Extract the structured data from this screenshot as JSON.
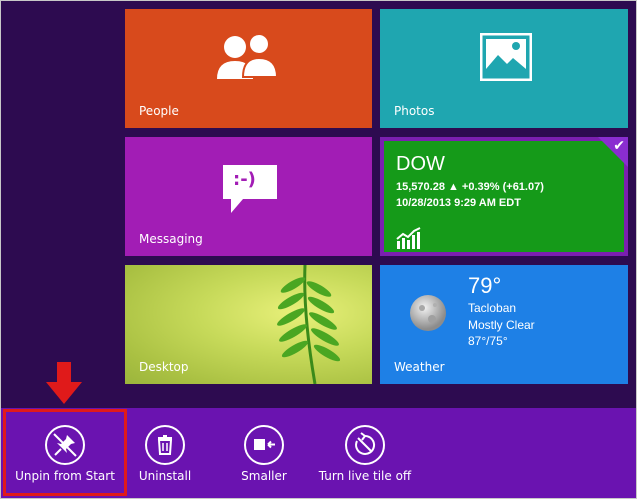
{
  "tiles": {
    "people": {
      "label": "People",
      "color": "#d84a1c"
    },
    "photos": {
      "label": "Photos",
      "color": "#1fa6b0"
    },
    "messaging": {
      "label": "Messaging",
      "color": "#a21db5",
      "icon_text": ":-)"
    },
    "dow": {
      "title": "DOW",
      "quote": "15,570.28 ▲ +0.39% (+61.07)",
      "timestamp": "10/28/2013 9:29 AM EDT",
      "color": "#159a19",
      "selected": true
    },
    "desktop": {
      "label": "Desktop"
    },
    "weather": {
      "label": "Weather",
      "temperature": "79°",
      "city": "Tacloban",
      "condition": "Mostly Clear",
      "range": "87°/75°",
      "color": "#1e80e6"
    }
  },
  "appbar": {
    "color": "#6a13b0",
    "commands": [
      {
        "label": "Unpin from Start",
        "icon": "unpin-icon"
      },
      {
        "label": "Uninstall",
        "icon": "trash-icon"
      },
      {
        "label": "Smaller",
        "icon": "resize-smaller-icon"
      },
      {
        "label": "Turn live tile off",
        "icon": "live-tile-off-icon"
      }
    ]
  },
  "annotation": {
    "highlight_color": "#e01a1a"
  }
}
